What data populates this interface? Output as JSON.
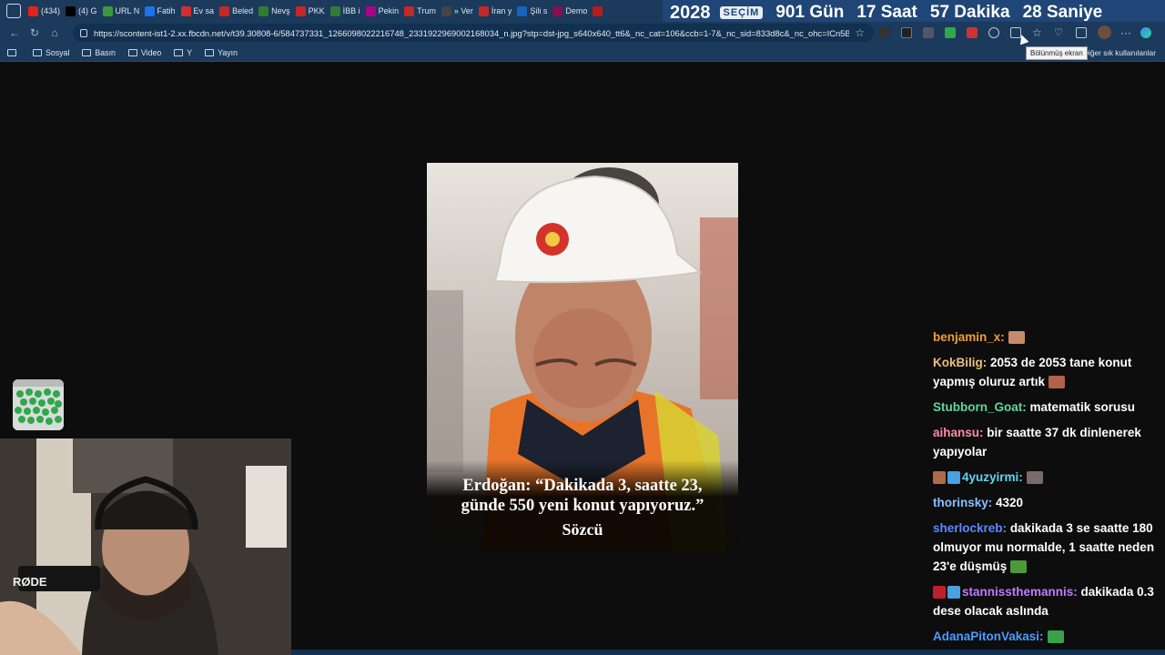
{
  "tabs": [
    {
      "title": "(434)",
      "color": "#e62117"
    },
    {
      "title": "(4) G",
      "color": "#000000"
    },
    {
      "title": "URL N",
      "color": "#3c9a3c"
    },
    {
      "title": "Fatih",
      "color": "#1a73e8"
    },
    {
      "title": "Ev sa",
      "color": "#d32f2f"
    },
    {
      "title": "Beled",
      "color": "#c62828"
    },
    {
      "title": "Nevş",
      "color": "#2e7d32"
    },
    {
      "title": "PKK",
      "color": "#c62828"
    },
    {
      "title": "İBB i",
      "color": "#2e7d32"
    },
    {
      "title": "Pekin",
      "color": "#b0008a"
    },
    {
      "title": "Trum",
      "color": "#c62828"
    },
    {
      "title": "» Ver",
      "color": "#444444"
    },
    {
      "title": "İran y",
      "color": "#c62828"
    },
    {
      "title": "Şili s",
      "color": "#1565c0"
    },
    {
      "title": "Demo",
      "color": "#880e4f"
    },
    {
      "title": "",
      "color": "#b71c1c"
    }
  ],
  "countdown": {
    "year": "2028",
    "label": "SEÇİM",
    "days": "901 Gün",
    "hours": "17 Saat",
    "minutes": "57 Dakika",
    "seconds": "28 Saniye"
  },
  "address": {
    "url": "https://scontent-ist1-2.xx.fbcdn.net/v/t39.30808-6/584737331_1266098022216748_2331922969002168034_n.jpg?stp=dst-jpg_s640x640_tt6&_nc_cat=106&ccb=1-7&_nc_sid=833d8c&_nc_ohc=ICn5Bn..."
  },
  "bookmarks": [
    "Sosyal",
    "Basın",
    "Video",
    "Y",
    "Yayın"
  ],
  "bookmarks_other": "Diğer sık kullanılanlar",
  "tooltip": "Bölünmüş ekran",
  "image": {
    "quote_line1": "Erdoğan: “Dakikada 3, saatte 23,",
    "quote_line2": "günde 550 yeni konut yapıyoruz.”",
    "brand": "Sözcü"
  },
  "chat": [
    {
      "user": "benjamin_x:",
      "color": "#f0a030",
      "text": "",
      "emote": "#c98a6a"
    },
    {
      "user": "KokBilig:",
      "color": "#e8c07a",
      "text": "2053 de 2053 tane konut yapmış oluruz artık",
      "emote": "#b0624a"
    },
    {
      "user": "Stubborn_Goat:",
      "color": "#5fd6a0",
      "text": "matematik sorusu"
    },
    {
      "user": "aihansu:",
      "color": "#ff8aa8",
      "text": "bir saatte 37 dk dinlenerek yapıyolar"
    },
    {
      "user": "4yuzyirmi:",
      "color": "#5fd6f0",
      "text": "",
      "emote": "#7a6a6a",
      "badges": [
        "#b06a4a",
        "#4aa0e0"
      ]
    },
    {
      "user": "thorinsky:",
      "color": "#88c0ff",
      "text": "4320"
    },
    {
      "user": "sherlockreb:",
      "color": "#5a8aff",
      "text": "dakikada 3 se saatte 180 olmuyor mu normalde, 1 saatte neden 23'e düşmüş",
      "emote": "#4a9a3a"
    },
    {
      "user": "stannissthemannis:",
      "color": "#c07aff",
      "text": "dakikada 0.3 dese olacak aslında",
      "badges": [
        "#c0202a",
        "#4aa0e0"
      ]
    },
    {
      "user": "AdanaPitonVakasi:",
      "color": "#4a9cff",
      "text": "",
      "emote": "#3aa04a"
    }
  ],
  "webcam": {
    "mic_brand": "RØDE"
  }
}
